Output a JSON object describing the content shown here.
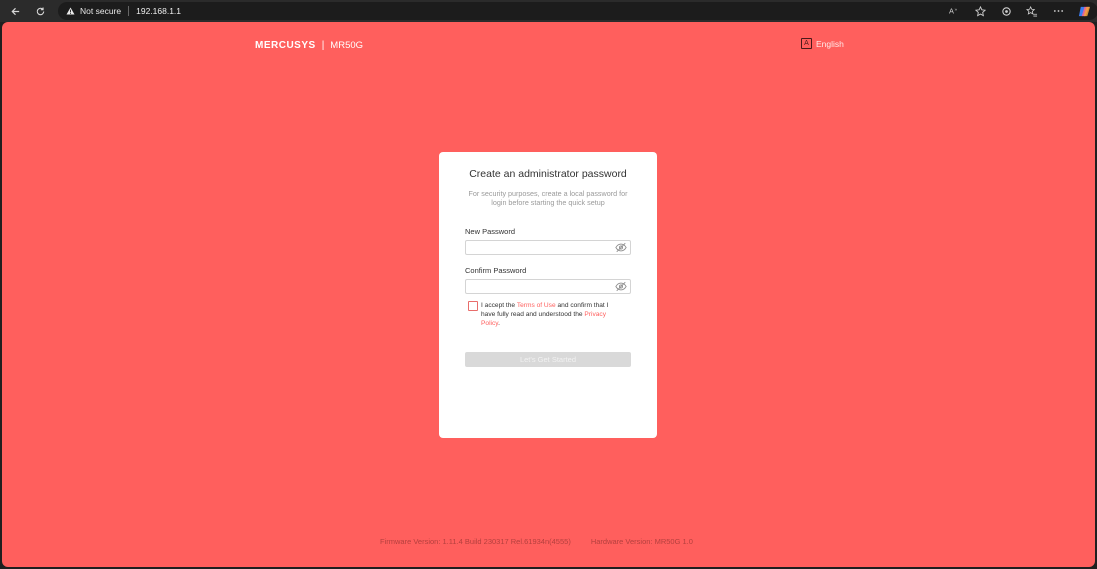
{
  "browser": {
    "back_icon": "arrow-left-icon",
    "reload_icon": "reload-icon",
    "security_label": "Not secure",
    "url": "192.168.1.1",
    "icons": [
      "read-aloud-icon",
      "favorite-icon",
      "extensions-icon",
      "favorites-bar-icon",
      "more-icon",
      "copilot-icon"
    ]
  },
  "header": {
    "brand": "MERCUSYS",
    "divider": "|",
    "model": "MR50G",
    "language_icon": "A",
    "language": "English"
  },
  "card": {
    "title": "Create an administrator password",
    "subtitle": "For security purposes, create a local password for login before starting the quick setup",
    "new_password_label": "New Password",
    "new_password_value": "",
    "confirm_password_label": "Confirm Password",
    "confirm_password_value": "",
    "terms_prefix": "I accept the ",
    "terms_link": "Terms of Use",
    "terms_middle": " and confirm that I have fully read and understood the ",
    "privacy_link": "Privacy Policy",
    "terms_suffix": ".",
    "button_label": "Let's Get Started"
  },
  "footer": {
    "firmware": "Firmware Version: 1.11.4 Build 230317 Rel.61934n(4555)",
    "hardware": "Hardware Version: MR50G 1.0"
  },
  "colors": {
    "background": "#ff5f5d",
    "accent": "#ff5f5d",
    "button_disabled": "#d9d9d9"
  }
}
